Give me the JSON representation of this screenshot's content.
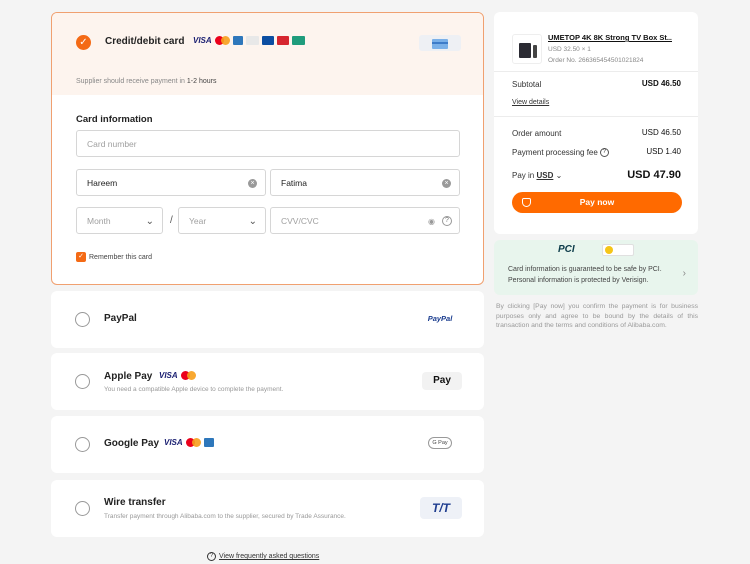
{
  "payment_methods": {
    "card": {
      "title": "Credit/debit card",
      "brands": [
        "VISA",
        "Mastercard",
        "Amex",
        "Discover",
        "JCB",
        "UnionPay",
        "Diners"
      ],
      "note_prefix": "Supplier should receive payment in ",
      "note_time": "1-2 hours",
      "section_title": "Card information",
      "card_number_placeholder": "Card number",
      "first_name": "Hareem",
      "last_name": "Fatima",
      "month_placeholder": "Month",
      "year_placeholder": "Year",
      "date_separator": "/",
      "cvv_placeholder": "CVV/CVC",
      "remember_label": "Remember this card",
      "selected": true
    },
    "paypal": {
      "title": "PayPal",
      "badge": "PayPal"
    },
    "apple_pay": {
      "title": "Apple Pay",
      "description": "You need a compatible Apple device to complete the payment.",
      "badge": "Pay"
    },
    "google_pay": {
      "title": "Google Pay",
      "badge": "G Pay"
    },
    "wire_transfer": {
      "title": "Wire transfer",
      "description": "Transfer payment through Alibaba.com to the supplier, secured by Trade Assurance.",
      "badge": "T/T"
    }
  },
  "faq_link": "View frequently asked questions",
  "order_summary": {
    "product_name": "UMETOP 4K 8K Strong TV Box St...",
    "product_price": "USD 32.50 × 1",
    "order_no": "Order No. 266365454501021824",
    "subtotal_label": "Subtotal",
    "subtotal_value": "USD 46.50",
    "view_details": "View details",
    "order_amount_label": "Order amount",
    "order_amount_value": "USD 46.50",
    "fee_label": "Payment processing fee",
    "fee_value": "USD 1.40",
    "pay_in_label": "Pay in",
    "currency": "USD",
    "total_value": "USD 47.90",
    "pay_button": "Pay now"
  },
  "security": {
    "pci_logo": "PCI",
    "text": "Card information is guaranteed to be safe by PCI. Personal information is protected by Verisign."
  },
  "disclaimer": "By clicking [Pay now] you confirm the payment is for business purposes only and agree to be bound by the details of this transaction and the terms and conditions of Alibaba.com.",
  "colors": {
    "accent": "#ff6a00",
    "selected_border": "#f0a070",
    "security_bg": "#e8f5ed"
  }
}
